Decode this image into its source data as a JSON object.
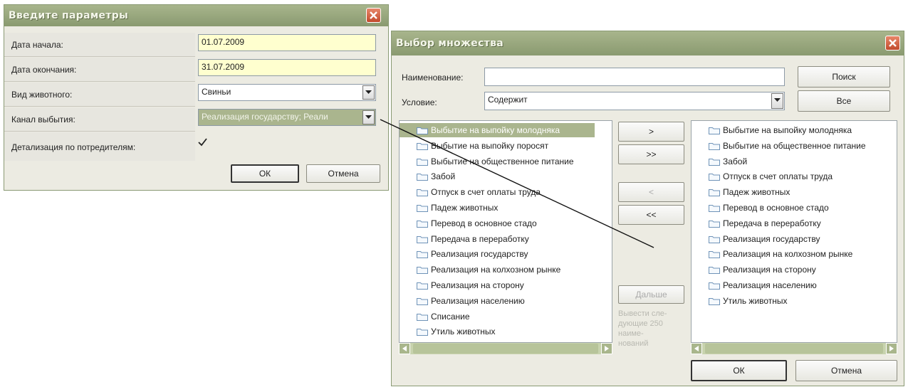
{
  "params_dialog": {
    "title": "Введите параметры",
    "fields": [
      {
        "label": "Дата начала:",
        "value": "01.07.2009"
      },
      {
        "label": "Дата окончания:",
        "value": "31.07.2009"
      },
      {
        "label": "Вид животного:",
        "value": "Свиньи"
      },
      {
        "label": "Канал выбытия:",
        "value": "Реализация государству; Реали"
      },
      {
        "label": "Детализация по потредителям:",
        "checked": true
      }
    ],
    "ok_label": "ОК",
    "cancel_label": "Отмена"
  },
  "set_dialog": {
    "title": "Выбор множества",
    "name_label": "Наименование:",
    "name_value": "",
    "condition_label": "Условие:",
    "condition_value": "Содержит",
    "search_label": "Поиск",
    "all_label": "Все",
    "left_items": [
      "Выбытие на выпойку молодняка",
      "Выбытие на выпойку поросят",
      "Выбытие на общественное питание",
      "Забой",
      "Отпуск в счет оплаты труда",
      "Падеж животных",
      "Перевод в основное стадо",
      "Передача в переработку",
      "Реализация государству",
      "Реализация на колхозном рынке",
      "Реализация на сторону",
      "Реализация населению",
      "Списание",
      "Утиль животных"
    ],
    "right_items": [
      "Выбытие на выпойку молодняка",
      "Выбытие на общественное питание",
      "Забой",
      "Отпуск в счет оплаты труда",
      "Падеж животных",
      "Перевод в основное стадо",
      "Передача в переработку",
      "Реализация государству",
      "Реализация на колхозном рынке",
      "Реализация на сторону",
      "Реализация населению",
      "Утиль животных"
    ],
    "move_buttons": [
      ">",
      ">>",
      "<",
      "<<"
    ],
    "next_label": "Дальше",
    "hint_lines": [
      "Вывести сле-",
      "дующие 250",
      "наиме-",
      "нований"
    ],
    "ok_label": "ОК",
    "cancel_label": "Отмена"
  },
  "colors": {
    "titlebar": "#8a9a70",
    "selection": "#aab58e",
    "close": "#c24a2c",
    "yellow_field": "#ffffcf"
  }
}
